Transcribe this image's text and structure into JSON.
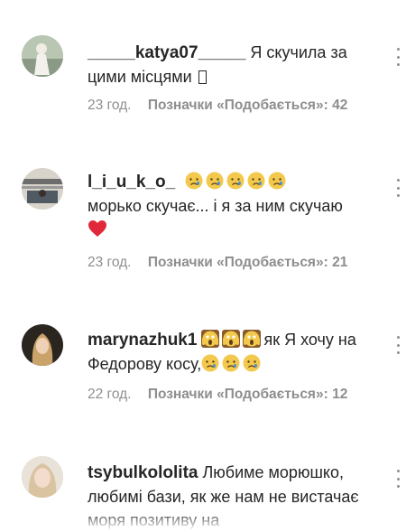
{
  "comments": [
    {
      "username": "_____katya07_____",
      "text": "Я скучила за цими місцями",
      "trailing_glyph": "missing-emoji-box",
      "time": "23 год.",
      "likes": "Позначки «Подобається»: 42"
    },
    {
      "username": "l_i_u_k_o_",
      "emoji_before": [
        "crying-face",
        "crying-face",
        "crying-face",
        "crying-face",
        "crying-face"
      ],
      "text": "морько скучає... і я за ним скучаю",
      "emoji_after": [
        "red-heart"
      ],
      "time": "23 год.",
      "likes": "Позначки «Подобається»: 21"
    },
    {
      "username": "marynazhuk1",
      "emoji_before": [
        "screaming-face",
        "screaming-face",
        "screaming-face"
      ],
      "text_part1": "як Я хочу на Федорову косу,",
      "emoji_after": [
        "sad-face",
        "sad-face",
        "sad-face"
      ],
      "time": "22 год.",
      "likes": "Позначки «Подобається»: 12"
    },
    {
      "username": "tsybulkololita",
      "text": "Любиме морюшко, любимі бази, як же нам не вистачає моря позитиву на"
    }
  ],
  "colors": {
    "text": "#262626",
    "meta": "#8e8e8e",
    "emoji_face": "#f2c94c",
    "emoji_tear": "#3a8ee6",
    "heart": "#e0283a"
  }
}
